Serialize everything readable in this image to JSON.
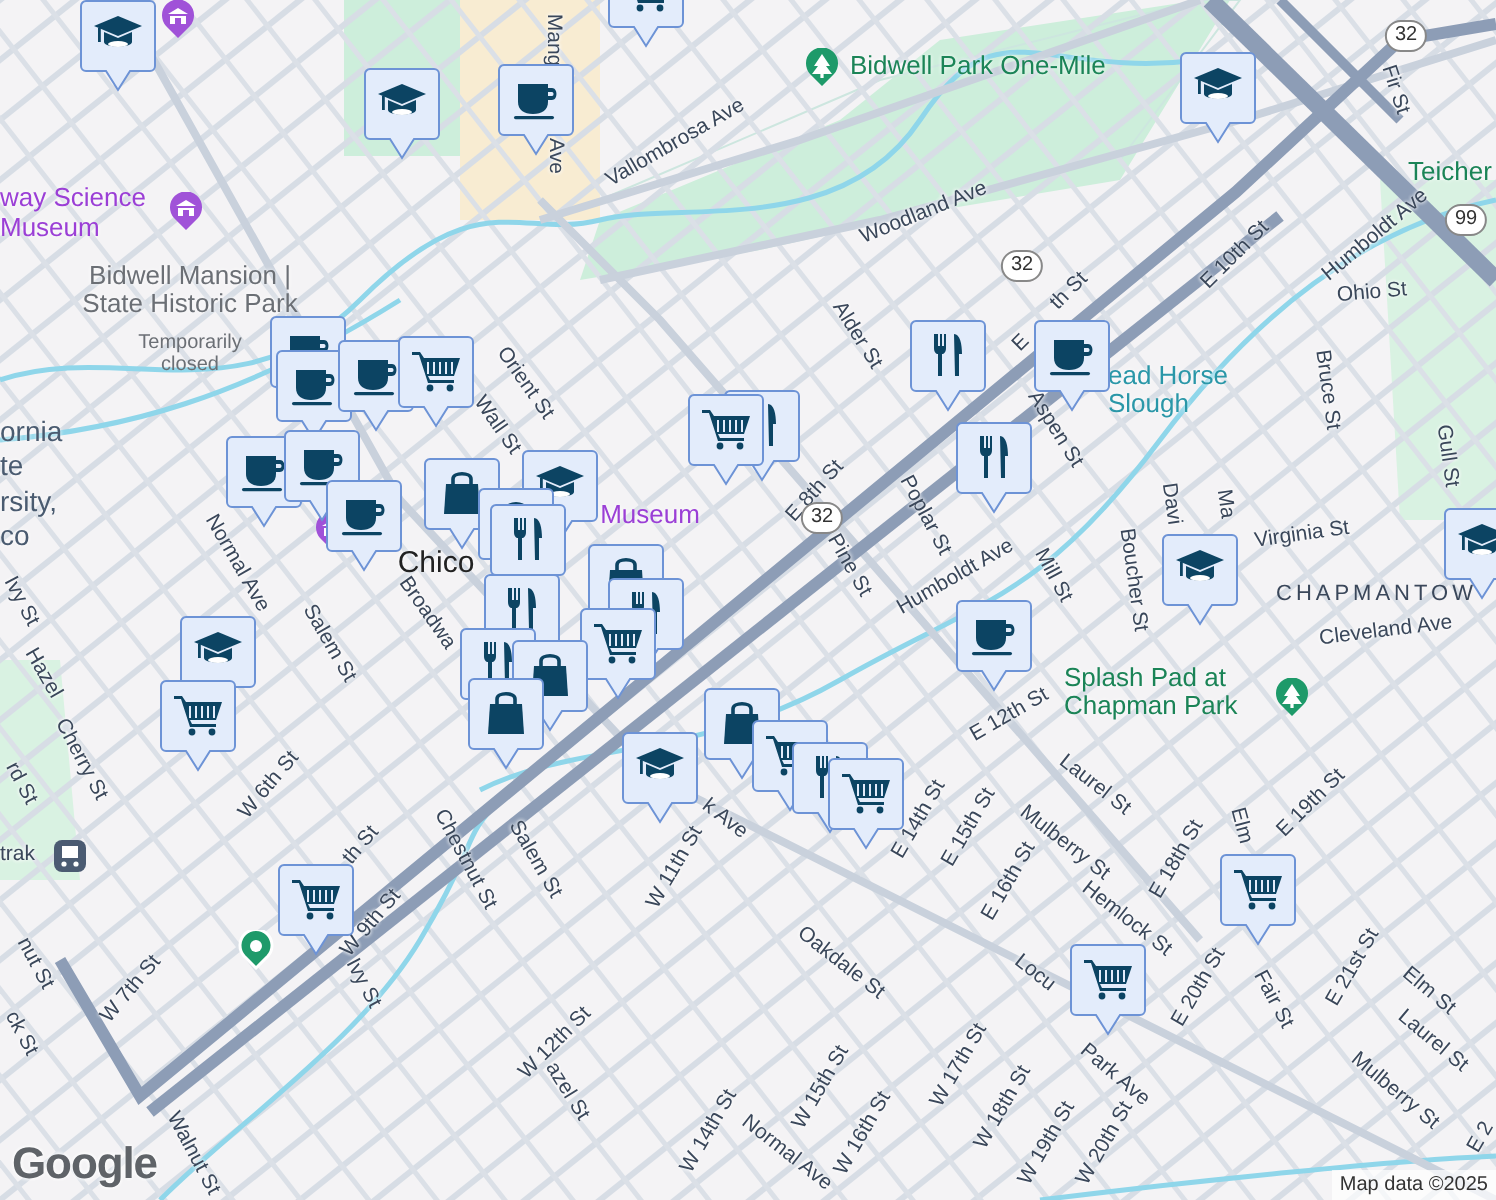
{
  "map": {
    "labels": [
      {
        "text": "Mang",
        "kind": "street"
      },
      {
        "text": "Ave",
        "kind": "street"
      },
      {
        "text": "Vallombrosa Ave",
        "kind": "street"
      },
      {
        "text": "Woodland Ave",
        "kind": "street"
      },
      {
        "text": "Orient St",
        "kind": "street"
      },
      {
        "text": "Alder St",
        "kind": "street"
      },
      {
        "text": "E 8th St",
        "kind": "street"
      },
      {
        "text": "Pine St",
        "kind": "street"
      },
      {
        "text": "Poplar St",
        "kind": "street"
      },
      {
        "text": "Humboldt Ave",
        "kind": "street"
      },
      {
        "text": "Mill St",
        "kind": "street"
      },
      {
        "text": "E",
        "kind": "street"
      },
      {
        "text": "th St",
        "kind": "street"
      },
      {
        "text": "E 10th St",
        "kind": "street"
      },
      {
        "text": "Humboldt Ave",
        "kind": "street"
      },
      {
        "text": "Ohio St",
        "kind": "street"
      },
      {
        "text": "Fir St",
        "kind": "street"
      },
      {
        "text": "Aspen St",
        "kind": "street"
      },
      {
        "text": "Bruce St",
        "kind": "street"
      },
      {
        "text": "Gull St",
        "kind": "street"
      },
      {
        "text": "Boucher St",
        "kind": "street"
      },
      {
        "text": "Davi",
        "kind": "street"
      },
      {
        "text": "Ma",
        "kind": "street"
      },
      {
        "text": "Virginia St",
        "kind": "street"
      },
      {
        "text": "Cleveland Ave",
        "kind": "street"
      },
      {
        "text": "E 12th St",
        "kind": "street"
      },
      {
        "text": "Laurel St",
        "kind": "street"
      },
      {
        "text": "Mulberry St",
        "kind": "street"
      },
      {
        "text": "E 18th St",
        "kind": "street"
      },
      {
        "text": "Elm",
        "kind": "street"
      },
      {
        "text": "E 19th St",
        "kind": "street"
      },
      {
        "text": "Hemlock St",
        "kind": "street"
      },
      {
        "text": "Locu",
        "kind": "street"
      },
      {
        "text": "E 20th St",
        "kind": "street"
      },
      {
        "text": "Fair St",
        "kind": "street"
      },
      {
        "text": "E 21st St",
        "kind": "street"
      },
      {
        "text": "Elm St",
        "kind": "street"
      },
      {
        "text": "Laurel St",
        "kind": "street"
      },
      {
        "text": "Mulberry St",
        "kind": "street"
      },
      {
        "text": "E 2",
        "kind": "street"
      },
      {
        "text": "Park Ave",
        "kind": "street"
      },
      {
        "text": "W 19th St",
        "kind": "street"
      },
      {
        "text": "W 20th St",
        "kind": "street"
      },
      {
        "text": "W 18th St",
        "kind": "street"
      },
      {
        "text": "W 17th St",
        "kind": "street"
      },
      {
        "text": "W 16th St",
        "kind": "street"
      },
      {
        "text": "W 15th St",
        "kind": "street"
      },
      {
        "text": "W 14th St",
        "kind": "street"
      },
      {
        "text": "Normal Ave",
        "kind": "street"
      },
      {
        "text": "Oakdale St",
        "kind": "street"
      },
      {
        "text": "E 14th St",
        "kind": "street"
      },
      {
        "text": "E 15th St",
        "kind": "street"
      },
      {
        "text": "E 16th St",
        "kind": "street"
      },
      {
        "text": "k Ave",
        "kind": "street"
      },
      {
        "text": "W 11th St",
        "kind": "street"
      },
      {
        "text": "Salem St",
        "kind": "street"
      },
      {
        "text": "Chestnut St",
        "kind": "street"
      },
      {
        "text": "W 12th St",
        "kind": "street"
      },
      {
        "text": "azel St",
        "kind": "street"
      },
      {
        "text": "W 9th St",
        "kind": "street"
      },
      {
        "text": "th St",
        "kind": "street"
      },
      {
        "text": "Ivy St",
        "kind": "street"
      },
      {
        "text": "Walnut St",
        "kind": "street"
      },
      {
        "text": "nut St",
        "kind": "street"
      },
      {
        "text": "ck St",
        "kind": "street"
      },
      {
        "text": "W 7th St",
        "kind": "street"
      },
      {
        "text": "W 6th St",
        "kind": "street"
      },
      {
        "text": "Cherry St",
        "kind": "street"
      },
      {
        "text": "Hazel",
        "kind": "street"
      },
      {
        "text": "Normal Ave",
        "kind": "street"
      },
      {
        "text": "Salem St",
        "kind": "street"
      },
      {
        "text": "Broadwa",
        "kind": "street"
      },
      {
        "text": "Wall St",
        "kind": "street"
      },
      {
        "text": "Ivy St",
        "kind": "street"
      },
      {
        "text": "rd St",
        "kind": "street"
      },
      {
        "text": "trak",
        "kind": "street"
      },
      {
        "text": "32",
        "kind": "shield"
      },
      {
        "text": "32",
        "kind": "shield"
      },
      {
        "text": "32",
        "kind": "shield"
      },
      {
        "text": "99",
        "kind": "shield"
      },
      {
        "text": "way Science Museum",
        "kind": "museum"
      },
      {
        "text": "Museum",
        "kind": "museum"
      },
      {
        "text": "Bidwell Mansion | State Historic Park",
        "kind": "place"
      },
      {
        "text": "Temporarily closed",
        "kind": "note"
      },
      {
        "text": "Bidwell Park One-Mile",
        "kind": "park"
      },
      {
        "text": "Splash Pad at Chapman Park",
        "kind": "park"
      },
      {
        "text": "Teicher",
        "kind": "park"
      },
      {
        "text": "ead Horse Slough",
        "kind": "water"
      },
      {
        "text": "ornia",
        "kind": "campus"
      },
      {
        "text": "te",
        "kind": "campus"
      },
      {
        "text": "rsity,",
        "kind": "campus"
      },
      {
        "text": "co",
        "kind": "campus"
      },
      {
        "text": "CHAPMANTOW",
        "kind": "area"
      },
      {
        "text": "Chico",
        "kind": "city"
      }
    ],
    "markers": [
      {
        "kind": "school"
      },
      {
        "kind": "grocery"
      },
      {
        "kind": "school"
      },
      {
        "kind": "cafe"
      },
      {
        "kind": "school"
      },
      {
        "kind": "cafe"
      },
      {
        "kind": "cafe"
      },
      {
        "kind": "cafe"
      },
      {
        "kind": "grocery"
      },
      {
        "kind": "restaurant"
      },
      {
        "kind": "cafe"
      },
      {
        "kind": "restaurant"
      },
      {
        "kind": "grocery"
      },
      {
        "kind": "restaurant"
      },
      {
        "kind": "cafe"
      },
      {
        "kind": "cafe"
      },
      {
        "kind": "school"
      },
      {
        "kind": "shopping"
      },
      {
        "kind": "cafe"
      },
      {
        "kind": "shopping"
      },
      {
        "kind": "restaurant"
      },
      {
        "kind": "shopping"
      },
      {
        "kind": "restaurant"
      },
      {
        "kind": "restaurant"
      },
      {
        "kind": "grocery"
      },
      {
        "kind": "school"
      },
      {
        "kind": "grocery"
      },
      {
        "kind": "restaurant"
      },
      {
        "kind": "shopping"
      },
      {
        "kind": "shopping"
      },
      {
        "kind": "school"
      },
      {
        "kind": "school"
      },
      {
        "kind": "cafe"
      },
      {
        "kind": "shopping"
      },
      {
        "kind": "grocery"
      },
      {
        "kind": "restaurant"
      },
      {
        "kind": "grocery"
      },
      {
        "kind": "school"
      },
      {
        "kind": "grocery"
      },
      {
        "kind": "grocery"
      },
      {
        "kind": "grocery"
      }
    ],
    "attribution": "Map data ©2025",
    "logo": "Google"
  }
}
